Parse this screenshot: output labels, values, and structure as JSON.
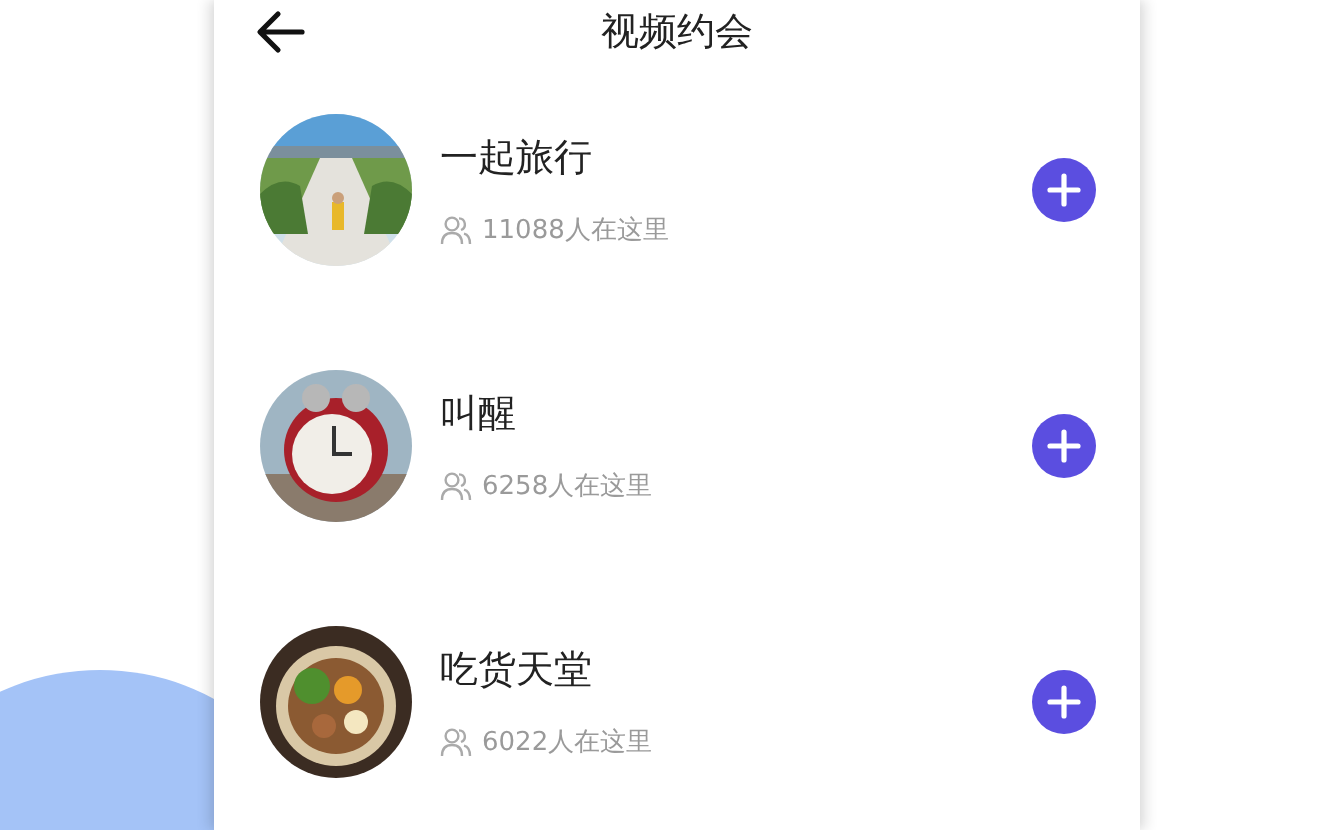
{
  "header": {
    "title": "视频约会"
  },
  "rooms": [
    {
      "name": "一起旅行",
      "count": "11088人在这里"
    },
    {
      "name": "叫醒",
      "count": "6258人在这里"
    },
    {
      "name": "吃货天堂",
      "count": "6022人在这里"
    }
  ]
}
